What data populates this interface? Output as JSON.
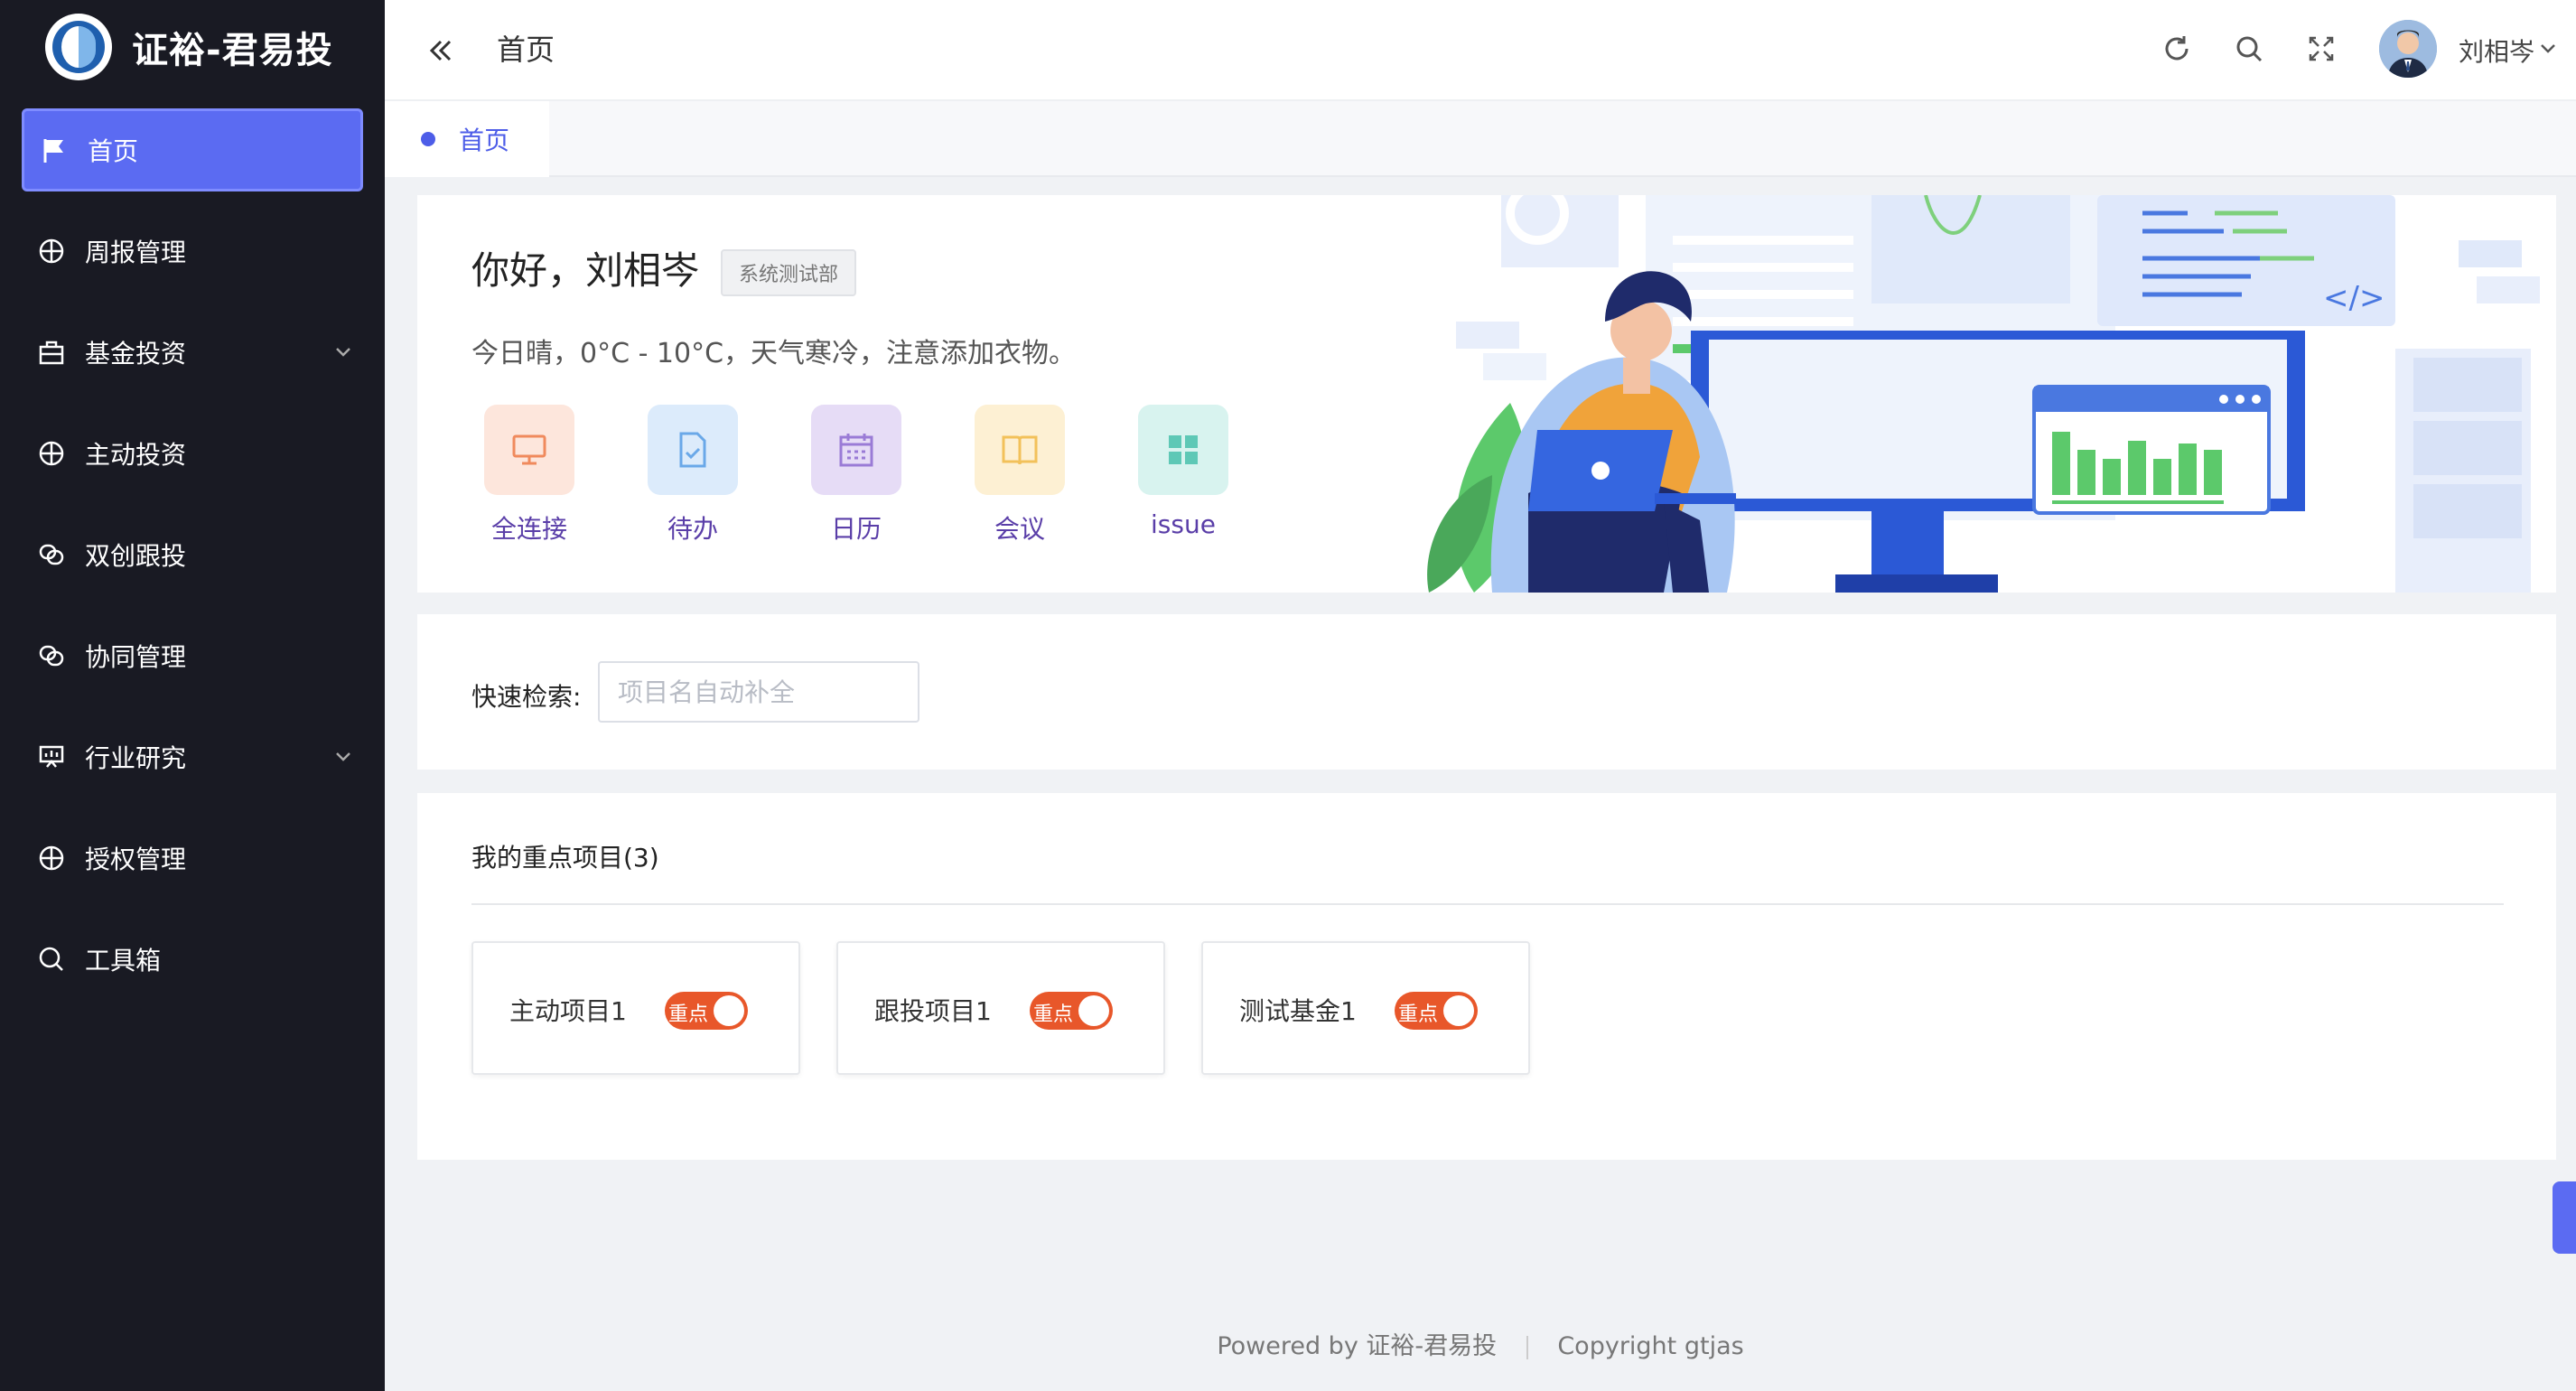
{
  "app": {
    "title": "证裕-君易投"
  },
  "sidebar": {
    "items": [
      {
        "label": "首页",
        "icon": "flag-icon",
        "active": true
      },
      {
        "label": "周报管理",
        "icon": "crosshair-icon"
      },
      {
        "label": "基金投资",
        "icon": "briefcase-icon",
        "expandable": true
      },
      {
        "label": "主动投资",
        "icon": "crosshair-icon"
      },
      {
        "label": "双创跟投",
        "icon": "link-icon"
      },
      {
        "label": "协同管理",
        "icon": "link-icon"
      },
      {
        "label": "行业研究",
        "icon": "presentation-icon",
        "expandable": true
      },
      {
        "label": "授权管理",
        "icon": "crosshair-icon"
      },
      {
        "label": "工具箱",
        "icon": "search-icon"
      }
    ]
  },
  "header": {
    "breadcrumb": "首页",
    "username": "刘相岑"
  },
  "tabs": [
    {
      "label": "首页",
      "active": true
    }
  ],
  "welcome": {
    "greeting": "你好，刘相岑",
    "department": "系统测试部",
    "weather": "今日晴，0°C - 10°C，天气寒冷，注意添加衣物。",
    "quick_links": [
      {
        "label": "全连接",
        "icon": "monitor-icon",
        "bg": "#fde6dc",
        "color": "#f08a5d"
      },
      {
        "label": "待办",
        "icon": "document-check-icon",
        "bg": "#dcebfb",
        "color": "#6aa8e8"
      },
      {
        "label": "日历",
        "icon": "calendar-icon",
        "bg": "#e6dcf6",
        "color": "#9a7bd6"
      },
      {
        "label": "会议",
        "icon": "book-icon",
        "bg": "#fdf0d3",
        "color": "#f2c15a"
      },
      {
        "label": "issue",
        "icon": "grid-icon",
        "bg": "#d8f3ef",
        "color": "#5ec8b6"
      }
    ]
  },
  "search": {
    "label": "快速检索:",
    "placeholder": "项目名自动补全",
    "value": ""
  },
  "projects": {
    "title": "我的重点项目(3)",
    "toggle_label": "重点",
    "items": [
      {
        "name": "主动项目1",
        "key": true
      },
      {
        "name": "跟投项目1",
        "key": true
      },
      {
        "name": "测试基金1",
        "key": true
      }
    ]
  },
  "footer": {
    "powered": "Powered by  证裕-君易投",
    "copyright": "Copyright  gtjas"
  },
  "colors": {
    "sidebar_bg": "#191a23",
    "accent": "#5b6bf2",
    "toggle": "#e8572a"
  }
}
